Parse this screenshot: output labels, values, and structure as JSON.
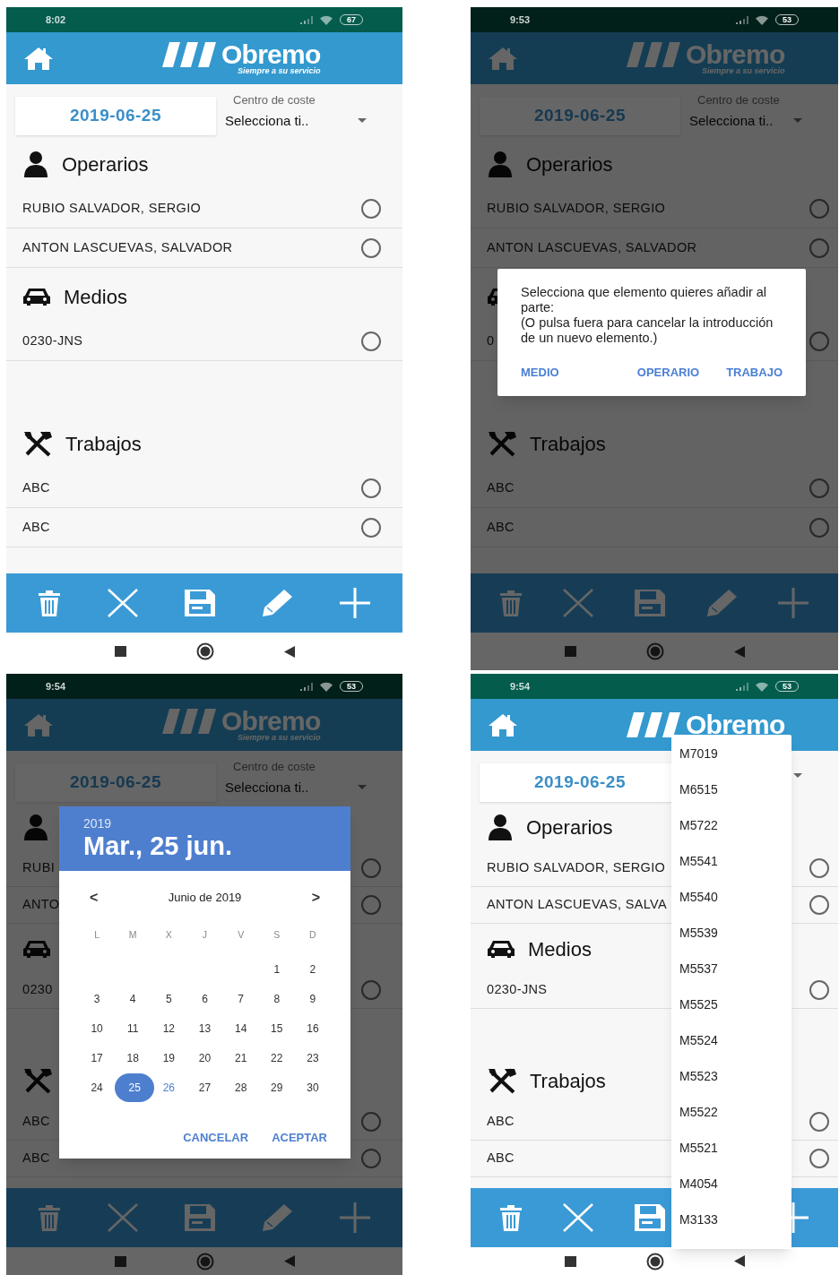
{
  "screens": [
    {
      "status_bar": {
        "time": "8:02",
        "battery": "67"
      },
      "header": {
        "logo": "Obremo",
        "tagline": "Siempre a su servicio"
      },
      "date": "2019-06-25",
      "cost_center": {
        "label": "Centro de coste",
        "value": "Selecciona ti.."
      },
      "sections": [
        {
          "kind": "operarios",
          "title": "Operarios",
          "items": [
            {
              "label": "RUBIO SALVADOR, SERGIO",
              "selected": false
            },
            {
              "label": "ANTON LASCUEVAS, SALVADOR",
              "selected": false
            }
          ]
        },
        {
          "kind": "medios",
          "title": "Medios",
          "items": [
            {
              "label": "0230-JNS",
              "selected": false
            }
          ]
        },
        {
          "kind": "trabajos",
          "title": "Trabajos",
          "items": [
            {
              "label": "ABC",
              "selected": false
            },
            {
              "label": "ABC",
              "selected": false
            }
          ]
        }
      ],
      "overlay": {
        "kind": "none"
      }
    },
    {
      "status_bar": {
        "time": "9:53",
        "battery": "53"
      },
      "header": {
        "logo": "Obremo",
        "tagline": "Siempre a su servicio"
      },
      "date": "2019-06-25",
      "cost_center": {
        "label": "Centro de coste",
        "value": "Selecciona ti.."
      },
      "sections": [
        {
          "kind": "operarios",
          "title": "Operarios",
          "items": [
            {
              "label": "RUBIO SALVADOR, SERGIO",
              "selected": false
            },
            {
              "label": "ANTON LASCUEVAS, SALVADOR",
              "selected": false
            }
          ]
        },
        {
          "kind": "medios",
          "items": [
            {
              "label": "0",
              "selected": false
            }
          ]
        },
        {
          "kind": "trabajos",
          "title": "Trabajos",
          "items": [
            {
              "label": "ABC",
              "selected": false
            },
            {
              "label": "ABC",
              "selected": false
            }
          ]
        }
      ],
      "overlay": {
        "kind": "dialog",
        "message": "Selecciona que elemento quieres añadir al parte:\n(O pulsa fuera para cancelar la introducción de un nuevo elemento.)",
        "buttons": [
          "MEDIO",
          "OPERARIO",
          "TRABAJO"
        ]
      }
    },
    {
      "status_bar": {
        "time": "9:54",
        "battery": "53"
      },
      "header": {
        "logo": "Obremo",
        "tagline": "Siempre a su servicio"
      },
      "date": "2019-06-25",
      "cost_center": {
        "label": "Centro de coste",
        "value": "Selecciona ti.."
      },
      "sections": [
        {
          "kind": "operarios",
          "items": [
            {
              "label": "RUBI",
              "selected": false
            },
            {
              "label": "ANTO",
              "selected": false
            }
          ]
        },
        {
          "kind": "medios",
          "items": [
            {
              "label": "0230",
              "selected": false
            }
          ]
        },
        {
          "kind": "trabajos",
          "items": [
            {
              "label": "ABC",
              "selected": false
            },
            {
              "label": "ABC",
              "selected": false
            }
          ]
        }
      ],
      "overlay": {
        "kind": "datepicker",
        "year": "2019",
        "date": "Mar., 25 jun.",
        "prev": "<",
        "month": "Junio de 2019",
        "next": ">",
        "weekdays": [
          "L",
          "M",
          "X",
          "J",
          "V",
          "S",
          "D"
        ],
        "weeks": [
          [
            {
              "label": "1",
              "selected": false,
              "today": false
            },
            {
              "label": "2",
              "selected": false,
              "today": false
            }
          ],
          [
            {
              "label": "3",
              "selected": false,
              "today": false
            },
            {
              "label": "4",
              "selected": false,
              "today": false
            },
            {
              "label": "5",
              "selected": false,
              "today": false
            },
            {
              "label": "6",
              "selected": false,
              "today": false
            },
            {
              "label": "7",
              "selected": false,
              "today": false
            },
            {
              "label": "8",
              "selected": false,
              "today": false
            },
            {
              "label": "9",
              "selected": false,
              "today": false
            }
          ],
          [
            {
              "label": "10",
              "selected": false,
              "today": false
            },
            {
              "label": "11",
              "selected": false,
              "today": false
            },
            {
              "label": "12",
              "selected": false,
              "today": false
            },
            {
              "label": "13",
              "selected": false,
              "today": false
            },
            {
              "label": "14",
              "selected": false,
              "today": false
            },
            {
              "label": "15",
              "selected": false,
              "today": false
            },
            {
              "label": "16",
              "selected": false,
              "today": false
            }
          ],
          [
            {
              "label": "17",
              "selected": false,
              "today": false
            },
            {
              "label": "18",
              "selected": false,
              "today": false
            },
            {
              "label": "19",
              "selected": false,
              "today": false
            },
            {
              "label": "20",
              "selected": false,
              "today": false
            },
            {
              "label": "21",
              "selected": false,
              "today": false
            },
            {
              "label": "22",
              "selected": false,
              "today": false
            },
            {
              "label": "23",
              "selected": false,
              "today": false
            }
          ],
          [
            {
              "label": "24",
              "selected": false,
              "today": false
            },
            {
              "label": "25",
              "selected": true,
              "today": false
            },
            {
              "label": "26",
              "selected": false,
              "today": true
            },
            {
              "label": "27",
              "selected": false,
              "today": false
            },
            {
              "label": "28",
              "selected": false,
              "today": false
            },
            {
              "label": "29",
              "selected": false,
              "today": false
            },
            {
              "label": "30",
              "selected": false,
              "today": false
            }
          ]
        ],
        "buttons": [
          "CANCELAR",
          "ACEPTAR"
        ]
      }
    },
    {
      "status_bar": {
        "time": "9:54",
        "battery": "53"
      },
      "header": {
        "logo": "Obremo"
      },
      "date": "2019-06-25",
      "sections": [
        {
          "kind": "operarios",
          "title": "Operarios",
          "items": [
            {
              "label": "RUBIO SALVADOR, SERGIO",
              "selected": false
            },
            {
              "label": "ANTON LASCUEVAS, SALVA",
              "selected": false
            }
          ]
        },
        {
          "kind": "medios",
          "title": "Medios",
          "items": [
            {
              "label": "0230-JNS",
              "selected": false
            }
          ]
        },
        {
          "kind": "trabajos",
          "title": "Trabajos",
          "items": [
            {
              "label": "ABC",
              "selected": false
            },
            {
              "label": "ABC",
              "selected": false
            }
          ]
        }
      ],
      "overlay": {
        "kind": "dropdown",
        "options": [
          "M7019",
          "M6515",
          "M5722",
          "M5541",
          "M5540",
          "M5539",
          "M5537",
          "M5525",
          "M5524",
          "M5523",
          "M5522",
          "M5521",
          "M4054",
          "M3133"
        ]
      }
    }
  ]
}
